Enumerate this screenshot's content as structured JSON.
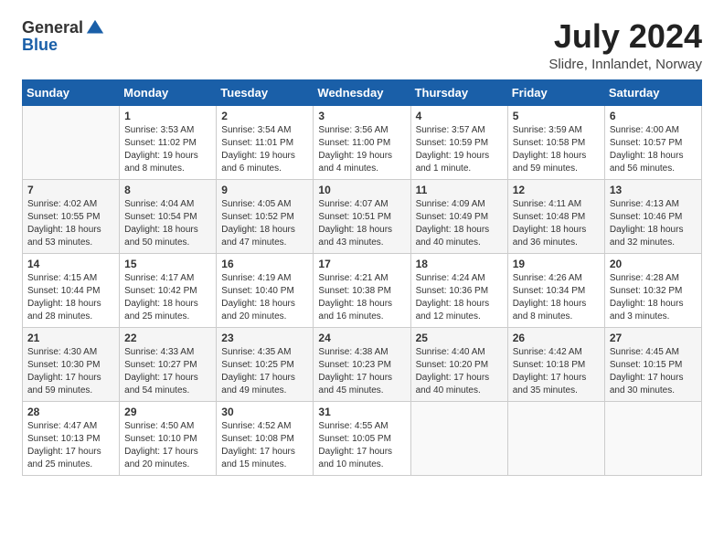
{
  "header": {
    "logo_general": "General",
    "logo_blue": "Blue",
    "month_title": "July 2024",
    "subtitle": "Slidre, Innlandet, Norway"
  },
  "weekdays": [
    "Sunday",
    "Monday",
    "Tuesday",
    "Wednesday",
    "Thursday",
    "Friday",
    "Saturday"
  ],
  "weeks": [
    [
      {
        "day": "",
        "sunrise": "",
        "sunset": "",
        "daylight": ""
      },
      {
        "day": "1",
        "sunrise": "Sunrise: 3:53 AM",
        "sunset": "Sunset: 11:02 PM",
        "daylight": "Daylight: 19 hours and 8 minutes."
      },
      {
        "day": "2",
        "sunrise": "Sunrise: 3:54 AM",
        "sunset": "Sunset: 11:01 PM",
        "daylight": "Daylight: 19 hours and 6 minutes."
      },
      {
        "day": "3",
        "sunrise": "Sunrise: 3:56 AM",
        "sunset": "Sunset: 11:00 PM",
        "daylight": "Daylight: 19 hours and 4 minutes."
      },
      {
        "day": "4",
        "sunrise": "Sunrise: 3:57 AM",
        "sunset": "Sunset: 10:59 PM",
        "daylight": "Daylight: 19 hours and 1 minute."
      },
      {
        "day": "5",
        "sunrise": "Sunrise: 3:59 AM",
        "sunset": "Sunset: 10:58 PM",
        "daylight": "Daylight: 18 hours and 59 minutes."
      },
      {
        "day": "6",
        "sunrise": "Sunrise: 4:00 AM",
        "sunset": "Sunset: 10:57 PM",
        "daylight": "Daylight: 18 hours and 56 minutes."
      }
    ],
    [
      {
        "day": "7",
        "sunrise": "Sunrise: 4:02 AM",
        "sunset": "Sunset: 10:55 PM",
        "daylight": "Daylight: 18 hours and 53 minutes."
      },
      {
        "day": "8",
        "sunrise": "Sunrise: 4:04 AM",
        "sunset": "Sunset: 10:54 PM",
        "daylight": "Daylight: 18 hours and 50 minutes."
      },
      {
        "day": "9",
        "sunrise": "Sunrise: 4:05 AM",
        "sunset": "Sunset: 10:52 PM",
        "daylight": "Daylight: 18 hours and 47 minutes."
      },
      {
        "day": "10",
        "sunrise": "Sunrise: 4:07 AM",
        "sunset": "Sunset: 10:51 PM",
        "daylight": "Daylight: 18 hours and 43 minutes."
      },
      {
        "day": "11",
        "sunrise": "Sunrise: 4:09 AM",
        "sunset": "Sunset: 10:49 PM",
        "daylight": "Daylight: 18 hours and 40 minutes."
      },
      {
        "day": "12",
        "sunrise": "Sunrise: 4:11 AM",
        "sunset": "Sunset: 10:48 PM",
        "daylight": "Daylight: 18 hours and 36 minutes."
      },
      {
        "day": "13",
        "sunrise": "Sunrise: 4:13 AM",
        "sunset": "Sunset: 10:46 PM",
        "daylight": "Daylight: 18 hours and 32 minutes."
      }
    ],
    [
      {
        "day": "14",
        "sunrise": "Sunrise: 4:15 AM",
        "sunset": "Sunset: 10:44 PM",
        "daylight": "Daylight: 18 hours and 28 minutes."
      },
      {
        "day": "15",
        "sunrise": "Sunrise: 4:17 AM",
        "sunset": "Sunset: 10:42 PM",
        "daylight": "Daylight: 18 hours and 25 minutes."
      },
      {
        "day": "16",
        "sunrise": "Sunrise: 4:19 AM",
        "sunset": "Sunset: 10:40 PM",
        "daylight": "Daylight: 18 hours and 20 minutes."
      },
      {
        "day": "17",
        "sunrise": "Sunrise: 4:21 AM",
        "sunset": "Sunset: 10:38 PM",
        "daylight": "Daylight: 18 hours and 16 minutes."
      },
      {
        "day": "18",
        "sunrise": "Sunrise: 4:24 AM",
        "sunset": "Sunset: 10:36 PM",
        "daylight": "Daylight: 18 hours and 12 minutes."
      },
      {
        "day": "19",
        "sunrise": "Sunrise: 4:26 AM",
        "sunset": "Sunset: 10:34 PM",
        "daylight": "Daylight: 18 hours and 8 minutes."
      },
      {
        "day": "20",
        "sunrise": "Sunrise: 4:28 AM",
        "sunset": "Sunset: 10:32 PM",
        "daylight": "Daylight: 18 hours and 3 minutes."
      }
    ],
    [
      {
        "day": "21",
        "sunrise": "Sunrise: 4:30 AM",
        "sunset": "Sunset: 10:30 PM",
        "daylight": "Daylight: 17 hours and 59 minutes."
      },
      {
        "day": "22",
        "sunrise": "Sunrise: 4:33 AM",
        "sunset": "Sunset: 10:27 PM",
        "daylight": "Daylight: 17 hours and 54 minutes."
      },
      {
        "day": "23",
        "sunrise": "Sunrise: 4:35 AM",
        "sunset": "Sunset: 10:25 PM",
        "daylight": "Daylight: 17 hours and 49 minutes."
      },
      {
        "day": "24",
        "sunrise": "Sunrise: 4:38 AM",
        "sunset": "Sunset: 10:23 PM",
        "daylight": "Daylight: 17 hours and 45 minutes."
      },
      {
        "day": "25",
        "sunrise": "Sunrise: 4:40 AM",
        "sunset": "Sunset: 10:20 PM",
        "daylight": "Daylight: 17 hours and 40 minutes."
      },
      {
        "day": "26",
        "sunrise": "Sunrise: 4:42 AM",
        "sunset": "Sunset: 10:18 PM",
        "daylight": "Daylight: 17 hours and 35 minutes."
      },
      {
        "day": "27",
        "sunrise": "Sunrise: 4:45 AM",
        "sunset": "Sunset: 10:15 PM",
        "daylight": "Daylight: 17 hours and 30 minutes."
      }
    ],
    [
      {
        "day": "28",
        "sunrise": "Sunrise: 4:47 AM",
        "sunset": "Sunset: 10:13 PM",
        "daylight": "Daylight: 17 hours and 25 minutes."
      },
      {
        "day": "29",
        "sunrise": "Sunrise: 4:50 AM",
        "sunset": "Sunset: 10:10 PM",
        "daylight": "Daylight: 17 hours and 20 minutes."
      },
      {
        "day": "30",
        "sunrise": "Sunrise: 4:52 AM",
        "sunset": "Sunset: 10:08 PM",
        "daylight": "Daylight: 17 hours and 15 minutes."
      },
      {
        "day": "31",
        "sunrise": "Sunrise: 4:55 AM",
        "sunset": "Sunset: 10:05 PM",
        "daylight": "Daylight: 17 hours and 10 minutes."
      },
      {
        "day": "",
        "sunrise": "",
        "sunset": "",
        "daylight": ""
      },
      {
        "day": "",
        "sunrise": "",
        "sunset": "",
        "daylight": ""
      },
      {
        "day": "",
        "sunrise": "",
        "sunset": "",
        "daylight": ""
      }
    ]
  ]
}
